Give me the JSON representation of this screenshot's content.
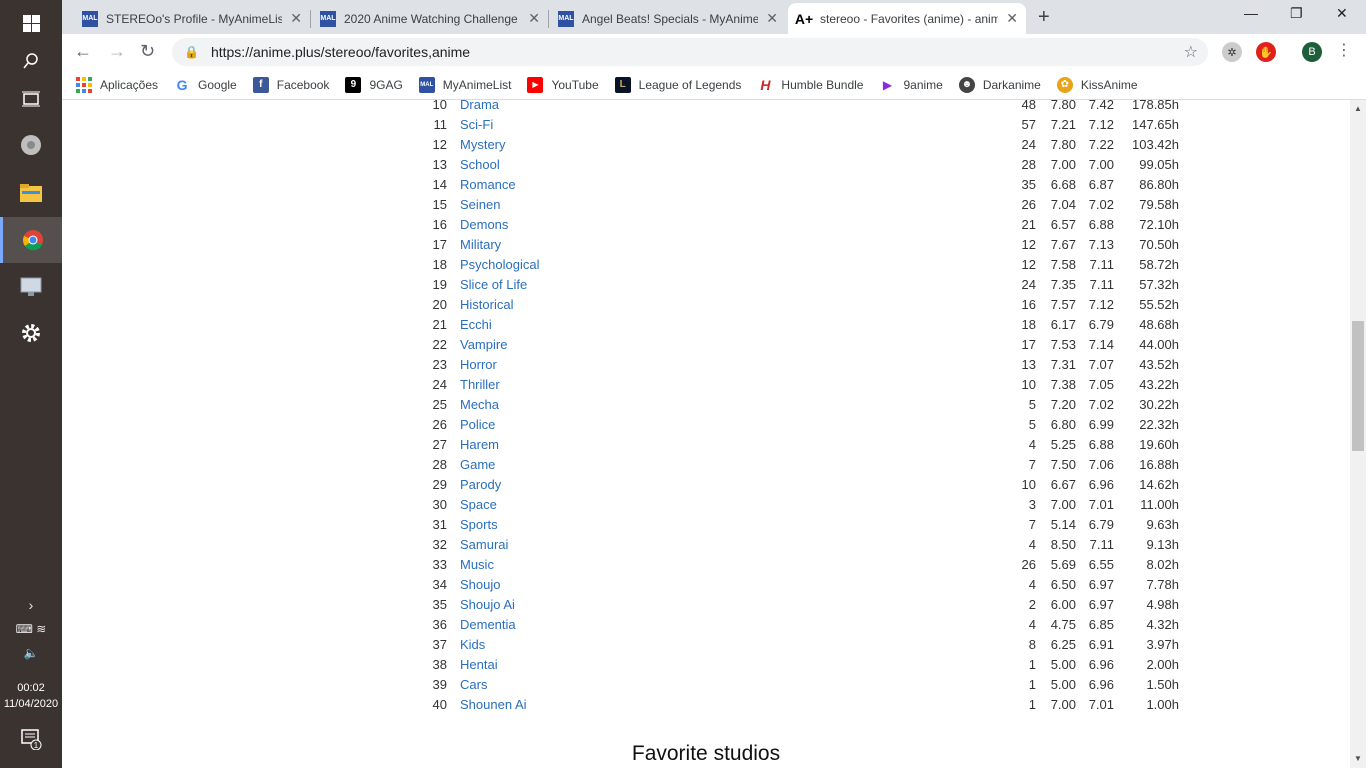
{
  "taskbar": {
    "clock_time": "00:02",
    "clock_date": "11/04/2020",
    "notification_count": "1"
  },
  "browser": {
    "tabs": [
      {
        "title": "STEREOo's Profile - MyAnimeList",
        "favicon": "MAL"
      },
      {
        "title": "2020 Anime Watching Challenge",
        "favicon": "MAL"
      },
      {
        "title": "Angel Beats! Specials - MyAnime",
        "favicon": "MAL"
      },
      {
        "title": "stereoo - Favorites (anime) - anim",
        "favicon": "A+"
      }
    ],
    "url": "https://anime.plus/stereoo/favorites,anime",
    "profile_initial": "B",
    "bookmarks": [
      {
        "label": "Aplicações",
        "color": "#e94235"
      },
      {
        "label": "Google",
        "color": "#4285f4"
      },
      {
        "label": "Facebook",
        "color": "#3b5998"
      },
      {
        "label": "9GAG",
        "color": "#000000"
      },
      {
        "label": "MyAnimeList",
        "color": "#2e51a2"
      },
      {
        "label": "YouTube",
        "color": "#ff0000"
      },
      {
        "label": "League of Legends",
        "color": "#c8aa6e"
      },
      {
        "label": "Humble Bundle",
        "color": "#cc2929"
      },
      {
        "label": "9anime",
        "color": "#8a2be2"
      },
      {
        "label": "Darkanime",
        "color": "#444444"
      },
      {
        "label": "KissAnime",
        "color": "#e8a317"
      }
    ]
  },
  "genres": [
    {
      "rank": "10",
      "name": "Drama",
      "count": "48",
      "mean": "7.80",
      "avg": "7.42",
      "hours": "178.85h"
    },
    {
      "rank": "11",
      "name": "Sci-Fi",
      "count": "57",
      "mean": "7.21",
      "avg": "7.12",
      "hours": "147.65h"
    },
    {
      "rank": "12",
      "name": "Mystery",
      "count": "24",
      "mean": "7.80",
      "avg": "7.22",
      "hours": "103.42h"
    },
    {
      "rank": "13",
      "name": "School",
      "count": "28",
      "mean": "7.00",
      "avg": "7.00",
      "hours": "99.05h"
    },
    {
      "rank": "14",
      "name": "Romance",
      "count": "35",
      "mean": "6.68",
      "avg": "6.87",
      "hours": "86.80h"
    },
    {
      "rank": "15",
      "name": "Seinen",
      "count": "26",
      "mean": "7.04",
      "avg": "7.02",
      "hours": "79.58h"
    },
    {
      "rank": "16",
      "name": "Demons",
      "count": "21",
      "mean": "6.57",
      "avg": "6.88",
      "hours": "72.10h"
    },
    {
      "rank": "17",
      "name": "Military",
      "count": "12",
      "mean": "7.67",
      "avg": "7.13",
      "hours": "70.50h"
    },
    {
      "rank": "18",
      "name": "Psychological",
      "count": "12",
      "mean": "7.58",
      "avg": "7.11",
      "hours": "58.72h"
    },
    {
      "rank": "19",
      "name": "Slice of Life",
      "count": "24",
      "mean": "7.35",
      "avg": "7.11",
      "hours": "57.32h"
    },
    {
      "rank": "20",
      "name": "Historical",
      "count": "16",
      "mean": "7.57",
      "avg": "7.12",
      "hours": "55.52h"
    },
    {
      "rank": "21",
      "name": "Ecchi",
      "count": "18",
      "mean": "6.17",
      "avg": "6.79",
      "hours": "48.68h"
    },
    {
      "rank": "22",
      "name": "Vampire",
      "count": "17",
      "mean": "7.53",
      "avg": "7.14",
      "hours": "44.00h"
    },
    {
      "rank": "23",
      "name": "Horror",
      "count": "13",
      "mean": "7.31",
      "avg": "7.07",
      "hours": "43.52h"
    },
    {
      "rank": "24",
      "name": "Thriller",
      "count": "10",
      "mean": "7.38",
      "avg": "7.05",
      "hours": "43.22h"
    },
    {
      "rank": "25",
      "name": "Mecha",
      "count": "5",
      "mean": "7.20",
      "avg": "7.02",
      "hours": "30.22h"
    },
    {
      "rank": "26",
      "name": "Police",
      "count": "5",
      "mean": "6.80",
      "avg": "6.99",
      "hours": "22.32h"
    },
    {
      "rank": "27",
      "name": "Harem",
      "count": "4",
      "mean": "5.25",
      "avg": "6.88",
      "hours": "19.60h"
    },
    {
      "rank": "28",
      "name": "Game",
      "count": "7",
      "mean": "7.50",
      "avg": "7.06",
      "hours": "16.88h"
    },
    {
      "rank": "29",
      "name": "Parody",
      "count": "10",
      "mean": "6.67",
      "avg": "6.96",
      "hours": "14.62h"
    },
    {
      "rank": "30",
      "name": "Space",
      "count": "3",
      "mean": "7.00",
      "avg": "7.01",
      "hours": "11.00h"
    },
    {
      "rank": "31",
      "name": "Sports",
      "count": "7",
      "mean": "5.14",
      "avg": "6.79",
      "hours": "9.63h"
    },
    {
      "rank": "32",
      "name": "Samurai",
      "count": "4",
      "mean": "8.50",
      "avg": "7.11",
      "hours": "9.13h"
    },
    {
      "rank": "33",
      "name": "Music",
      "count": "26",
      "mean": "5.69",
      "avg": "6.55",
      "hours": "8.02h"
    },
    {
      "rank": "34",
      "name": "Shoujo",
      "count": "4",
      "mean": "6.50",
      "avg": "6.97",
      "hours": "7.78h"
    },
    {
      "rank": "35",
      "name": "Shoujo Ai",
      "count": "2",
      "mean": "6.00",
      "avg": "6.97",
      "hours": "4.98h"
    },
    {
      "rank": "36",
      "name": "Dementia",
      "count": "4",
      "mean": "4.75",
      "avg": "6.85",
      "hours": "4.32h"
    },
    {
      "rank": "37",
      "name": "Kids",
      "count": "8",
      "mean": "6.25",
      "avg": "6.91",
      "hours": "3.97h"
    },
    {
      "rank": "38",
      "name": "Hentai",
      "count": "1",
      "mean": "5.00",
      "avg": "6.96",
      "hours": "2.00h"
    },
    {
      "rank": "39",
      "name": "Cars",
      "count": "1",
      "mean": "5.00",
      "avg": "6.96",
      "hours": "1.50h"
    },
    {
      "rank": "40",
      "name": "Shounen Ai",
      "count": "1",
      "mean": "7.00",
      "avg": "7.01",
      "hours": "1.00h"
    }
  ],
  "section": {
    "studios_title": "Favorite studios"
  },
  "colors": {
    "link": "#2a6fbf",
    "taskbar": "#3a3330",
    "tabstrip": "#dee1e6"
  }
}
